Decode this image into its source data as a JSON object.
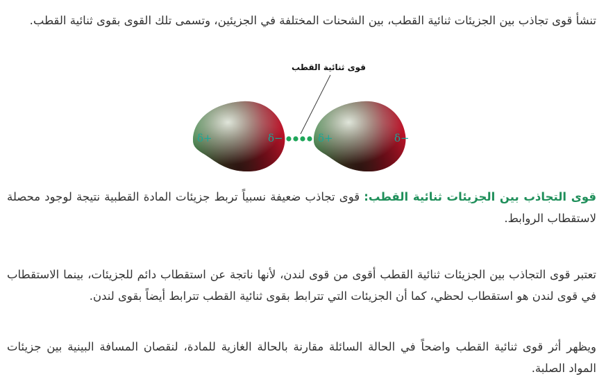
{
  "intro": "تنشأ قوى تجاذب بين الجزيئات ثنائية القطب، بين الشحنات المختلفة في الجزيئين، وتسمى تلك القوى بقوى ثنائية القطب.",
  "figure": {
    "label": "قوى ثنائية القطب",
    "molecule_1": {
      "left_charge": "δ+",
      "right_charge": "δ−"
    },
    "molecule_2": {
      "left_charge": "δ+",
      "right_charge": "δ−"
    },
    "interaction_dots": 4,
    "colors": {
      "positive_end": "#2e7d3a",
      "negative_end": "#c0142a",
      "highlight": "#e8eee4",
      "dots": "#1fa65a",
      "charge_text": "#19a89a"
    }
  },
  "definition": {
    "term": "قوى التجاذب بين الجزيئات ثنائية القطب:",
    "text": " قوى تجاذب ضعيفة نسبياً تربط جزيئات المادة القطبية نتيجة لوجود محصلة لاستقطاب الروابط."
  },
  "comparison": "تعتبر قوى التجاذب بين الجزيئات ثنائية القطب أقوى من قوى لندن، لأنها ناتجة عن استقطاب دائم للجزيئات، بينما الاستقطاب في قوى لندن هو استقطاب لحظي، كما أن الجزيئات التي تترابط بقوى ثنائية القطب تترابط أيضاً بقوى لندن.",
  "liquid_effect": "ويظهر أثر قوى ثنائية القطب واضحاً في الحالة السائلة مقارنة بالحالة الغازية للمادة، لنقصان المسافة البينية بين جزيئات المواد الصلبة."
}
